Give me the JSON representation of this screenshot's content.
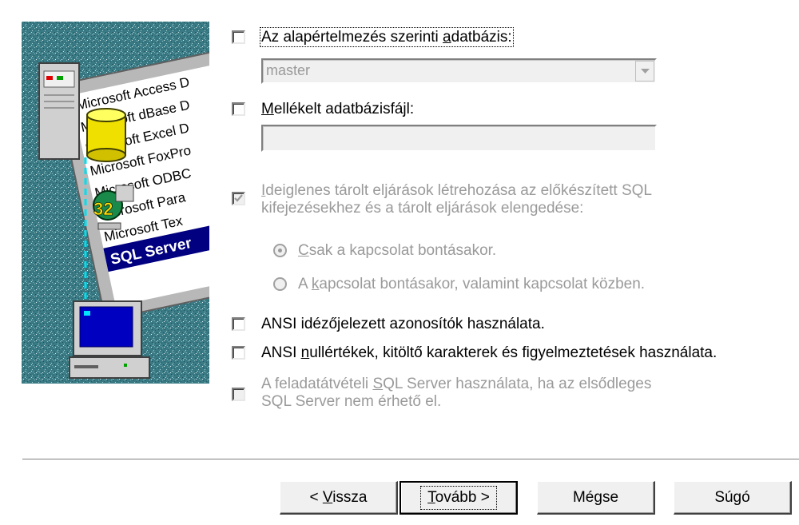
{
  "illustration": {
    "list_items": [
      "Microsoft Access D",
      "Microsoft dBase D",
      "Microsoft Excel D",
      "Microsoft FoxPro",
      "Microsoft ODBC",
      "Microsoft Para",
      "Microsoft Tex",
      "SQL Server"
    ],
    "badge_number": "32"
  },
  "options": {
    "default_db": {
      "pre": "Az alapértelmezés szerinti ",
      "accel": "a",
      "post": "datbázis:",
      "checked": false
    },
    "default_db_select": {
      "value": "master"
    },
    "attach_file": {
      "accel": "M",
      "post": "ellékelt adatbázisfájl:",
      "checked": false
    },
    "attach_file_input": {
      "value": ""
    },
    "temp_procs": {
      "accel": "I",
      "line1": "deiglenes tárolt eljárások létrehozása az előkészített SQL",
      "line2": "kifejezésekhez és a tárolt eljárások elengedése:",
      "checked": true
    },
    "radio_disconnect": {
      "accel": "C",
      "post": "sak a kapcsolat bontásakor.",
      "selected": true
    },
    "radio_both": {
      "pre": "A ",
      "accel": "k",
      "post": "apcsolat bontásakor, valamint kapcsolat közben.",
      "selected": false
    },
    "ansi_quoted": {
      "pre": "ANSI idézőjelezett azonosítók használata.",
      "checked": false
    },
    "ansi_nulls": {
      "pre": "ANSI ",
      "accel": "n",
      "post": "ullértékek, kitöltő karakterek és figyelmeztetések használata.",
      "checked": false
    },
    "failover": {
      "pre": "A feladatátvételi ",
      "accel": "S",
      "post": "QL Server használata, ha az elsődleges",
      "line2": "SQL Server nem érhető el.",
      "checked": false
    }
  },
  "buttons": {
    "back": {
      "pre": "< ",
      "accel": "V",
      "post": "issza"
    },
    "next": {
      "accel": "T",
      "post": "ovább >"
    },
    "cancel": {
      "label": "Mégse"
    },
    "help": {
      "label": "Súgó"
    }
  },
  "colors": {
    "disabled_text": "#9a9a9a",
    "illustration_bg": "#2e6f7b",
    "sql_highlight": "#000080"
  }
}
